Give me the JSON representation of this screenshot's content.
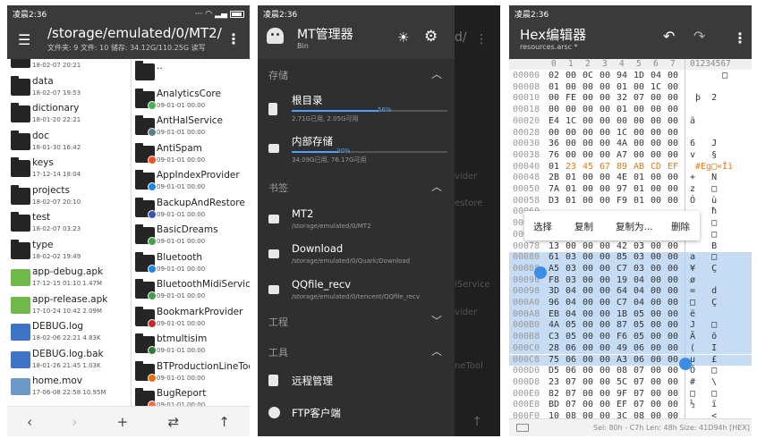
{
  "status": {
    "time": "凌晨2:36"
  },
  "files": {
    "path": "/storage/emulated/0/MT2/",
    "summary": "文件夹: 9  文件: 10  储存: 34.12G/110.25G  读写",
    "left": [
      {
        "name": "",
        "date": "18-02-07 20:21",
        "kind": "folder"
      },
      {
        "name": "data",
        "date": "18-02-07 19:53",
        "kind": "folder"
      },
      {
        "name": "dictionary",
        "date": "18-01-20 22:21",
        "kind": "folder"
      },
      {
        "name": "doc",
        "date": "18-01-30 16:42",
        "kind": "folder"
      },
      {
        "name": "keys",
        "date": "17-12-14 18:04",
        "kind": "folder"
      },
      {
        "name": "projects",
        "date": "18-02-07 20:10",
        "kind": "folder"
      },
      {
        "name": "test",
        "date": "18-02-07 03:23",
        "kind": "folder"
      },
      {
        "name": "type",
        "date": "18-02-02 19:49",
        "kind": "folder"
      },
      {
        "name": "app-debug.apk",
        "date": "17-12-15 01:10  1.47M",
        "kind": "apk"
      },
      {
        "name": "app-release.apk",
        "date": "17-10-24 10:42  2.09M",
        "kind": "apk"
      },
      {
        "name": "DEBUG.log",
        "date": "18-02-06 22:21  4.83K",
        "kind": "log"
      },
      {
        "name": "DEBUG.log.bak",
        "date": "18-01-26 21:45  1.03K",
        "kind": "log"
      },
      {
        "name": "home.mov",
        "date": "17-06-08 22:58  10.95M",
        "kind": "mov"
      }
    ],
    "right": [
      {
        "name": "..",
        "date": ""
      },
      {
        "name": "AnalyticsCore",
        "date": "09-01-01 00:00"
      },
      {
        "name": "AntHalService",
        "date": "09-01-01 00:00"
      },
      {
        "name": "AntiSpam",
        "date": "09-01-01 00:00"
      },
      {
        "name": "AppIndexProvider",
        "date": "09-01-01 00:00"
      },
      {
        "name": "BackupAndRestore",
        "date": "09-01-01 00:00"
      },
      {
        "name": "BasicDreams",
        "date": "09-01-01 00:00"
      },
      {
        "name": "Bluetooth",
        "date": "09-01-01 00:00"
      },
      {
        "name": "BluetoothMidiService",
        "date": "09-01-01 00:00"
      },
      {
        "name": "BookmarkProvider",
        "date": "09-01-01 00:00"
      },
      {
        "name": "btmultisim",
        "date": "09-01-01 00:00"
      },
      {
        "name": "BTProductionLineTool",
        "date": "09-01-01 00:00"
      },
      {
        "name": "BugReport",
        "date": "09-01-01 00:00"
      }
    ],
    "nav": {
      "back": "‹",
      "forward": "›",
      "add": "+",
      "swap": "⇄",
      "up": "↑"
    }
  },
  "drawer": {
    "title": "MT管理器",
    "subtitle": "Bin",
    "storage_header": "存储",
    "storage": [
      {
        "name": "根目录",
        "info": "2.71G已用, 2.05G可用",
        "percent": "56%",
        "fill": 0.56
      },
      {
        "name": "内部存储",
        "info": "34.09G已用, 76.17G可用",
        "percent": "30%",
        "fill": 0.3
      }
    ],
    "bookmarks_header": "书签",
    "bookmarks": [
      {
        "name": "MT2",
        "path": "/storage/emulated/0/MT2"
      },
      {
        "name": "Download",
        "path": "/storage/emulated/0/Quark/Download"
      },
      {
        "name": "QQfile_recv",
        "path": "/storage/emulated/0/tencent/QQfile_recv"
      }
    ],
    "project_header": "工程",
    "tools_header": "工具",
    "tools": [
      {
        "name": "远程管理"
      },
      {
        "name": "FTP客户端"
      }
    ],
    "behind": [
      "d/",
      "vider",
      "estore",
      "iService",
      "vider",
      "neTool"
    ]
  },
  "hex": {
    "title": "Hex编辑器",
    "file": "resources.arsc *",
    "col_header": [
      "0",
      "1",
      "2",
      "3",
      "4",
      "5",
      "6",
      "7"
    ],
    "ascii_header": "01234567",
    "rows": [
      {
        "off": "00000",
        "b": [
          "02",
          "00",
          "0C",
          "00",
          "94",
          "1D",
          "04",
          "00"
        ],
        "a": "      □ "
      },
      {
        "off": "00008",
        "b": [
          "01",
          "00",
          "00",
          "00",
          "01",
          "00",
          "1C",
          "00"
        ],
        "a": "        "
      },
      {
        "off": "00010",
        "b": [
          "00",
          "FE",
          "00",
          "00",
          "32",
          "07",
          "00",
          "00"
        ],
        "a": " þ  2   "
      },
      {
        "off": "00018",
        "b": [
          "00",
          "00",
          "00",
          "00",
          "01",
          "00",
          "00",
          "00"
        ],
        "a": "        "
      },
      {
        "off": "00020",
        "b": [
          "E4",
          "1C",
          "00",
          "00",
          "00",
          "00",
          "00",
          "00"
        ],
        "a": "ä       "
      },
      {
        "off": "00028",
        "b": [
          "00",
          "00",
          "00",
          "00",
          "1C",
          "00",
          "00",
          "00"
        ],
        "a": "        "
      },
      {
        "off": "00030",
        "b": [
          "36",
          "00",
          "00",
          "00",
          "4A",
          "00",
          "00",
          "00"
        ],
        "a": "6   J   "
      },
      {
        "off": "00038",
        "b": [
          "76",
          "00",
          "00",
          "00",
          "A7",
          "00",
          "00",
          "00"
        ],
        "a": "v   §   "
      },
      {
        "off": "00040",
        "b": [
          "01",
          "23",
          "45",
          "67",
          "89",
          "AB",
          "CD",
          "EF"
        ],
        "a": " #Eg□«Íï"
      },
      {
        "off": "00048",
        "b": [
          "2B",
          "01",
          "00",
          "00",
          "4E",
          "01",
          "00",
          "00"
        ],
        "a": "+   N   "
      },
      {
        "off": "00050",
        "b": [
          "7A",
          "01",
          "00",
          "00",
          "97",
          "01",
          "00",
          "00"
        ],
        "a": "z   □   "
      },
      {
        "off": "00058",
        "b": [
          "D3",
          "01",
          "00",
          "00",
          "F9",
          "01",
          "00",
          "00"
        ],
        "a": "Ó   ù   "
      },
      {
        "off": "00060",
        "b": [
          "",
          "",
          "",
          "",
          "",
          "",
          "",
          ""
        ],
        "a": "    ħ   "
      },
      {
        "off": "00068",
        "b": [
          "",
          "",
          "",
          "",
          "",
          "",
          "",
          ""
        ],
        "a": "    □   "
      },
      {
        "off": "00070",
        "b": [
          "",
          "",
          "",
          "",
          "",
          "",
          "",
          ""
        ],
        "a": "    □   "
      },
      {
        "off": "00078",
        "b": [
          "13",
          "00",
          "00",
          "00",
          "42",
          "03",
          "00",
          "00"
        ],
        "a": "    B   "
      },
      {
        "off": "00080",
        "b": [
          "61",
          "03",
          "00",
          "00",
          "85",
          "03",
          "00",
          "00"
        ],
        "a": "a   □   "
      },
      {
        "off": "00088",
        "b": [
          "A5",
          "03",
          "00",
          "00",
          "C7",
          "03",
          "00",
          "00"
        ],
        "a": "¥   Ç   "
      },
      {
        "off": "00090",
        "b": [
          "F8",
          "03",
          "00",
          "00",
          "19",
          "04",
          "00",
          "00"
        ],
        "a": "ø       "
      },
      {
        "off": "00098",
        "b": [
          "3D",
          "04",
          "00",
          "00",
          "64",
          "04",
          "00",
          "00"
        ],
        "a": "=   d   "
      },
      {
        "off": "000A0",
        "b": [
          "96",
          "04",
          "00",
          "00",
          "C7",
          "04",
          "00",
          "00"
        ],
        "a": "□   Ç   "
      },
      {
        "off": "000A8",
        "b": [
          "EB",
          "04",
          "00",
          "00",
          "1B",
          "05",
          "00",
          "00"
        ],
        "a": "ë       "
      },
      {
        "off": "000B0",
        "b": [
          "4A",
          "05",
          "00",
          "00",
          "87",
          "05",
          "00",
          "00"
        ],
        "a": "J   □   "
      },
      {
        "off": "000B8",
        "b": [
          "C3",
          "05",
          "00",
          "00",
          "F6",
          "05",
          "00",
          "00"
        ],
        "a": "Ã   ö   "
      },
      {
        "off": "000C0",
        "b": [
          "28",
          "06",
          "00",
          "00",
          "49",
          "06",
          "00",
          "00"
        ],
        "a": "(   I   "
      },
      {
        "off": "000C8",
        "b": [
          "75",
          "06",
          "00",
          "00",
          "A3",
          "06",
          "00",
          "00"
        ],
        "a": "u   £   "
      },
      {
        "off": "000D0",
        "b": [
          "D5",
          "06",
          "00",
          "00",
          "08",
          "07",
          "00",
          "00"
        ],
        "a": "Õ   □   "
      },
      {
        "off": "000D8",
        "b": [
          "23",
          "07",
          "00",
          "00",
          "5C",
          "07",
          "00",
          "00"
        ],
        "a": "#   \\   "
      },
      {
        "off": "000E0",
        "b": [
          "82",
          "07",
          "00",
          "00",
          "9F",
          "07",
          "00",
          "00"
        ],
        "a": "□   □   "
      },
      {
        "off": "000E8",
        "b": [
          "BD",
          "07",
          "00",
          "00",
          "EF",
          "07",
          "00",
          "00"
        ],
        "a": "½   ï   "
      },
      {
        "off": "000F0",
        "b": [
          "10",
          "08",
          "00",
          "00",
          "3C",
          "08",
          "00",
          "00"
        ],
        "a": "    <   "
      }
    ],
    "menu": [
      "选择",
      "复制",
      "复制为...",
      "删除"
    ],
    "footer": "Sel: 80h - C7h  Len: 48h  Size: 41D94h [HEX]"
  },
  "colors": {
    "accent": "#4ba3ff",
    "orange": "#e07b1a",
    "selection": "#c5dcf4"
  }
}
